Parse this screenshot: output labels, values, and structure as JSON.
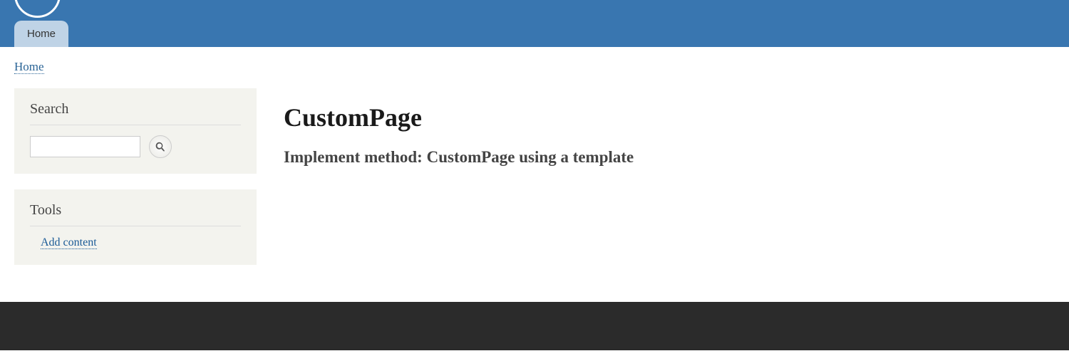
{
  "nav": {
    "tabs": [
      {
        "label": "Home"
      }
    ]
  },
  "breadcrumb": {
    "items": [
      {
        "label": "Home"
      }
    ]
  },
  "sidebar": {
    "search": {
      "title": "Search",
      "input_value": "",
      "placeholder": ""
    },
    "tools": {
      "title": "Tools",
      "links": [
        {
          "label": "Add content"
        }
      ]
    }
  },
  "main": {
    "title": "CustomPage",
    "subtitle": "Implement method: CustomPage using a template"
  }
}
